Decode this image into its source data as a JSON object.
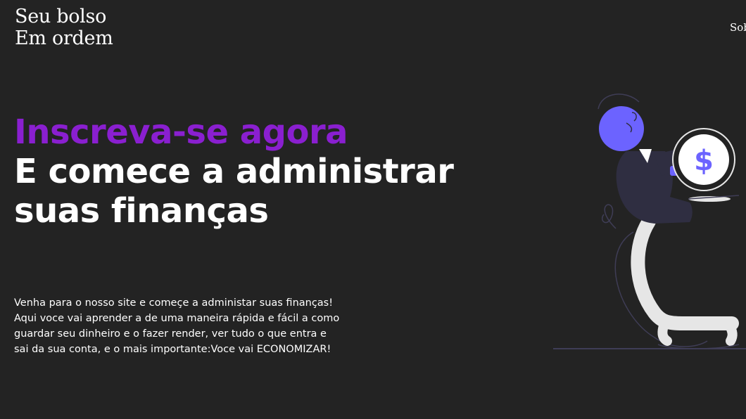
{
  "header": {
    "logo_line1": "Seu bolso",
    "logo_line2": "Em ordem",
    "nav_link": "Sob"
  },
  "hero": {
    "headline_accent": "Inscreva-se agora",
    "headline_line2": "E comece a administrar",
    "headline_line3": "suas finanças",
    "description_lines": [
      "Venha para o nosso site e começe a administar suas finanças!",
      "Aqui voce vai aprender a de uma maneira rápida e fácil a como",
      "guardar seu dinheiro e o fazer render, ver tudo o que entra e",
      "sai da sua conta, e o mais importante:Voce vai ECONOMIZAR!"
    ],
    "coin_symbol": "$"
  },
  "colors": {
    "background": "#232323",
    "accent": "#8a1fd0",
    "illustration_head": "#6c63ff",
    "suit": "#2f2e41",
    "chair": "#e6e6e6"
  },
  "icons": {
    "illustration": "person-holding-dollar-coin-illustration"
  }
}
